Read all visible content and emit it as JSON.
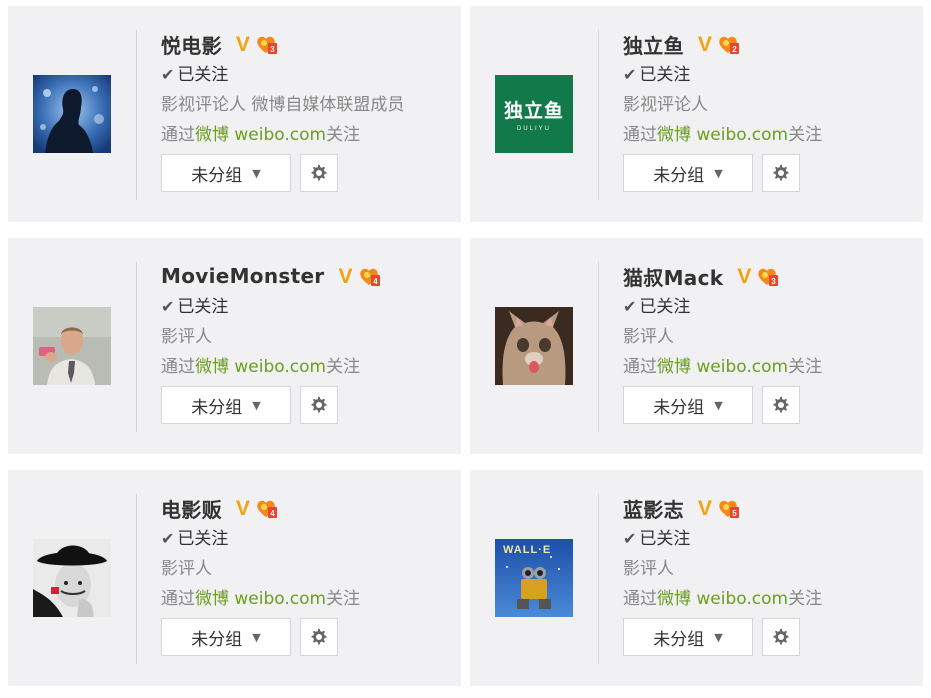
{
  "cards": [
    {
      "name": "悦电影",
      "followed": "已关注",
      "desc": "影视评论人  微博自媒体联盟成员",
      "via_prefix": "通过",
      "via_app": "微博 weibo.com",
      "via_suffix": "关注",
      "group_label": "未分组",
      "level": "3"
    },
    {
      "name": "独立鱼",
      "followed": "已关注",
      "desc": "影视评论人",
      "via_prefix": "通过",
      "via_app": "微博 weibo.com",
      "via_suffix": "关注",
      "group_label": "未分组",
      "level": "2",
      "avatar_text": "独立鱼",
      "avatar_subtext": "DULIYU"
    },
    {
      "name": "MovieMonster",
      "followed": "已关注",
      "desc": "影评人",
      "via_prefix": "通过",
      "via_app": "微博 weibo.com",
      "via_suffix": "关注",
      "group_label": "未分组",
      "level": "4"
    },
    {
      "name": "猫叔Mack",
      "followed": "已关注",
      "desc": "影评人",
      "via_prefix": "通过",
      "via_app": "微博 weibo.com",
      "via_suffix": "关注",
      "group_label": "未分组",
      "level": "3"
    },
    {
      "name": "电影贩",
      "followed": "已关注",
      "desc": "影评人",
      "via_prefix": "通过",
      "via_app": "微博 weibo.com",
      "via_suffix": "关注",
      "group_label": "未分组",
      "level": "4"
    },
    {
      "name": "蓝影志",
      "followed": "已关注",
      "desc": "影评人",
      "via_prefix": "通过",
      "via_app": "微博 weibo.com",
      "via_suffix": "关注",
      "group_label": "未分组",
      "level": "5",
      "avatar_text": "WALL·E"
    }
  ],
  "colors": {
    "card_bg": "#f1f1f3",
    "verified_badge": "#f2a20c",
    "level_badge": "#f28a1b",
    "link_green": "#6a9f20"
  },
  "icons": {
    "check": "check-icon",
    "caret": "caret-down-icon",
    "gear": "gear-icon",
    "verified": "verified-v-icon",
    "level": "level-badge-icon"
  }
}
